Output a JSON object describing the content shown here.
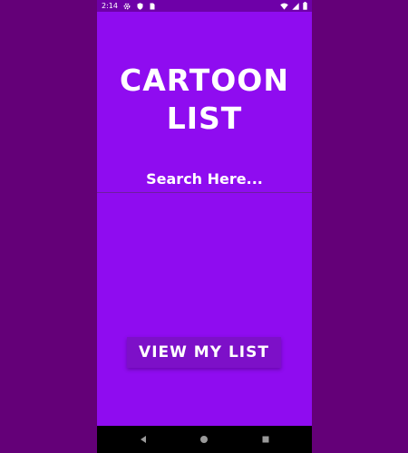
{
  "status_bar": {
    "time": "2:14",
    "icons": [
      "settings-icon",
      "shield-icon",
      "sim-card-icon",
      "wifi-icon",
      "signal-icon",
      "battery-icon"
    ]
  },
  "main": {
    "title_line1": "CARTOON",
    "title_line2": "LIST",
    "search_placeholder": "Search Here...",
    "view_button_label": "VIEW MY LIST"
  },
  "nav_bar": {
    "icons": [
      "back-icon",
      "home-icon",
      "recents-icon"
    ]
  },
  "colors": {
    "background": "#640078",
    "app_background": "#8f0cf0",
    "status_bar": "#6e00a8",
    "button": "#7d10c8",
    "text": "#ffffff"
  }
}
